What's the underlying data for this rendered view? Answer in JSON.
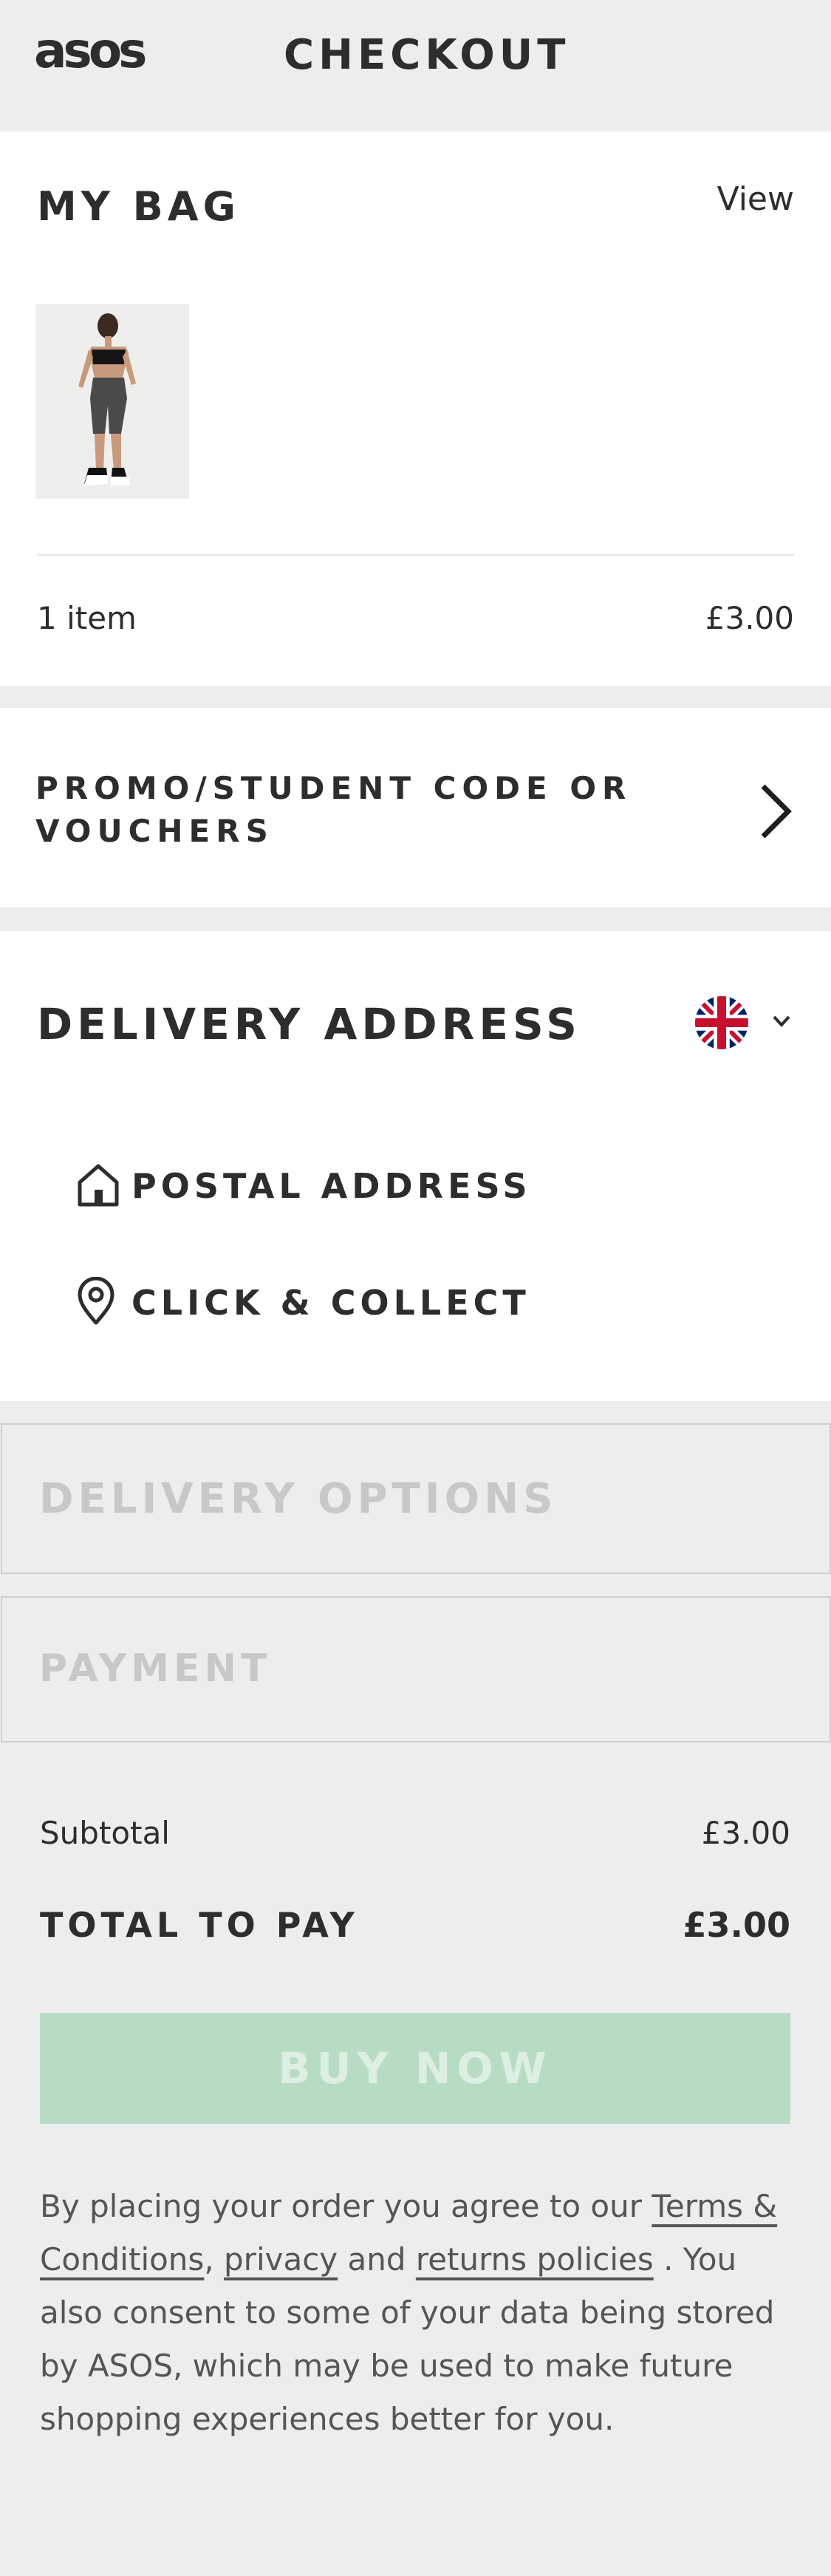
{
  "header": {
    "logo": "asos",
    "title": "CHECKOUT"
  },
  "bag": {
    "title": "MY BAG",
    "view_link": "View",
    "item_count": "1 item",
    "total": "£3.00"
  },
  "promo": {
    "label": "PROMO/STUDENT CODE OR VOUCHERS"
  },
  "delivery_address": {
    "title": "DELIVERY ADDRESS",
    "country_flag": "uk-flag-icon",
    "options": [
      {
        "label": "POSTAL ADDRESS",
        "icon": "house-icon"
      },
      {
        "label": "CLICK & COLLECT",
        "icon": "location-pin-icon"
      }
    ]
  },
  "delivery_options": {
    "title": "DELIVERY OPTIONS"
  },
  "payment": {
    "title": "PAYMENT"
  },
  "summary": {
    "subtotal_label": "Subtotal",
    "subtotal_value": "£3.00",
    "total_label": "TOTAL TO PAY",
    "total_value": "£3.00"
  },
  "buy_button": {
    "label": "BUY NOW"
  },
  "legal": {
    "text_1": "By placing your order you agree to our ",
    "terms_link": "Terms & Conditions",
    "sep": ", ",
    "privacy_link": "privacy",
    "and": " and ",
    "returns_link": "returns policies",
    "text_2": " . You also consent to some of your data being stored by ASOS, which may be used to make future shopping experiences better for you."
  },
  "colors": {
    "background": "#ededed",
    "panel": "#ffffff",
    "text": "#2d2d2d",
    "disabled_text": "#c8c8c8",
    "buy_button_disabled": "#b8dcc3"
  }
}
